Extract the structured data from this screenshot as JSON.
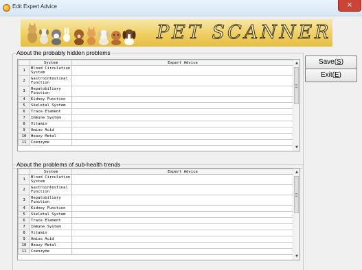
{
  "window": {
    "title": "Edit Expert Advice",
    "close_glyph": "×"
  },
  "banner": {
    "title": "PET SCANNER"
  },
  "columns": {
    "system": "System",
    "advice": "Expert Advice"
  },
  "groups": {
    "hidden": {
      "legend": "About the probably hidden problems"
    },
    "subhealth": {
      "legend": "About the problems of sub-health trends"
    }
  },
  "rows": [
    {
      "num": "1",
      "system": "Blood Circulation System",
      "advice": ""
    },
    {
      "num": "2",
      "system": "Gastrointestinal Function",
      "advice": ""
    },
    {
      "num": "3",
      "system": "Hepatobiliary Function",
      "advice": ""
    },
    {
      "num": "4",
      "system": "Kidney Function",
      "advice": ""
    },
    {
      "num": "5",
      "system": "Skeletal System",
      "advice": ""
    },
    {
      "num": "6",
      "system": "Trace Element",
      "advice": ""
    },
    {
      "num": "7",
      "system": "Immune System",
      "advice": ""
    },
    {
      "num": "8",
      "system": "Vitamin",
      "advice": ""
    },
    {
      "num": "9",
      "system": "Amino Acid",
      "advice": ""
    },
    {
      "num": "10",
      "system": "Heavy Metal",
      "advice": ""
    },
    {
      "num": "11",
      "system": "Coenzyme",
      "advice": ""
    }
  ],
  "buttons": {
    "save": {
      "text": "Save(",
      "hotkey": "S",
      "close": ")"
    },
    "exit": {
      "text": "Exit(",
      "hotkey": "E",
      "close": ")"
    }
  },
  "scroll": {
    "up": "▲",
    "down": "▼"
  },
  "colors": {
    "banner": "#efcf62",
    "close": "#c94538"
  }
}
